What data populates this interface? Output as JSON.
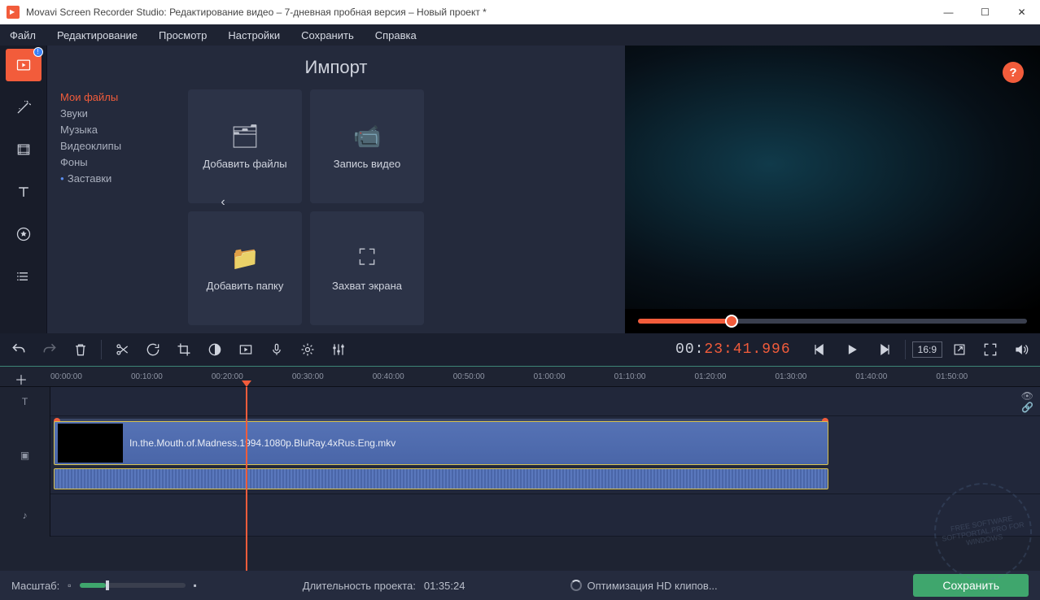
{
  "window": {
    "title": "Movavi Screen Recorder Studio: Редактирование видео – 7-дневная пробная версия – Новый проект *"
  },
  "menu": {
    "file": "Файл",
    "edit": "Редактирование",
    "view": "Просмотр",
    "settings": "Настройки",
    "save": "Сохранить",
    "help": "Справка"
  },
  "lefttabs": {
    "import": "import",
    "wand": "filters",
    "transitions": "transitions",
    "text": "text",
    "stickers": "stickers",
    "more": "more"
  },
  "import": {
    "title": "Импорт",
    "categories": {
      "myfiles": "Мои файлы",
      "sounds": "Звуки",
      "music": "Музыка",
      "clips": "Видеоклипы",
      "backgrounds": "Фоны",
      "intros": "Заставки"
    },
    "tiles": {
      "add_files": "Добавить файлы",
      "record_video": "Запись видео",
      "add_folder": "Добавить папку",
      "screen_capture": "Захват экрана"
    }
  },
  "preview": {
    "help": "?",
    "playback_progress_pct": 24
  },
  "timecode": {
    "prefix": "00:",
    "main": "23:41.996"
  },
  "controls": {
    "aspect": "16:9"
  },
  "timeline": {
    "ticks": [
      "00:00:00",
      "00:10:00",
      "00:20:00",
      "00:30:00",
      "00:40:00",
      "00:50:00",
      "01:00:00",
      "01:10:00",
      "01:20:00",
      "01:30:00",
      "01:40:00",
      "01:50:00"
    ],
    "clip_name": "In.the.Mouth.of.Madness.1994.1080p.BluRay.4xRus.Eng.mkv",
    "playhead_tick": "00:20:00"
  },
  "bottom": {
    "zoom_label": "Масштаб:",
    "duration_label": "Длительность проекта:",
    "duration_value": "01:35:24",
    "optimizing": "Оптимизация HD клипов...",
    "save": "Сохранить"
  },
  "watermark": "FREE SOFTWARE SOFTPORTAL.PRO FOR WINDOWS"
}
